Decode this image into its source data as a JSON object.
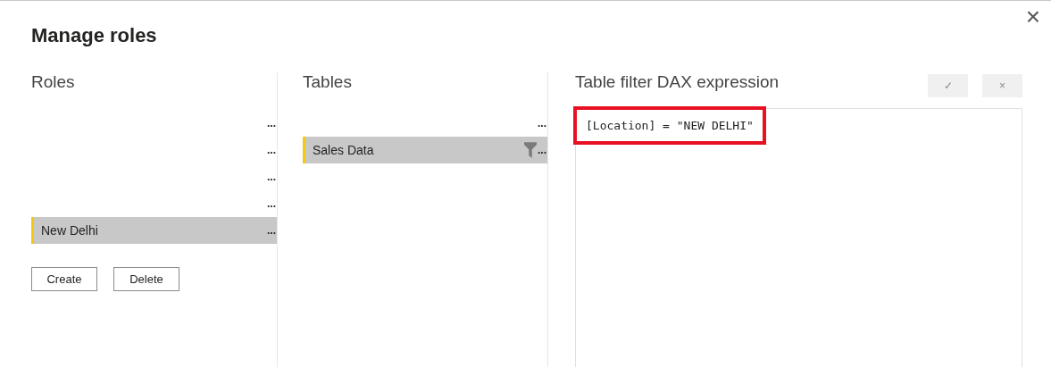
{
  "dialog": {
    "title": "Manage roles",
    "close": "×"
  },
  "roles": {
    "heading": "Roles",
    "items": [
      {
        "menu": "...",
        "selected": false
      },
      {
        "menu": "...",
        "selected": false
      },
      {
        "menu": "...",
        "selected": false
      },
      {
        "menu": "...",
        "selected": false
      },
      {
        "name": "New Delhi",
        "menu": "...",
        "selected": true
      }
    ],
    "buttons": [
      "Create",
      "Delete"
    ]
  },
  "tables": {
    "heading": "Tables",
    "items": [
      {
        "menu": "...",
        "selected": false,
        "filtered": false
      },
      {
        "name": "Sales Data",
        "menu": "...",
        "selected": true,
        "filtered": true
      }
    ]
  },
  "expression": {
    "heading": "Table filter DAX expression",
    "confirm": "✓",
    "cancel": "×",
    "value": "[Location] = \"NEW DELHI\"",
    "highlighted": true
  }
}
